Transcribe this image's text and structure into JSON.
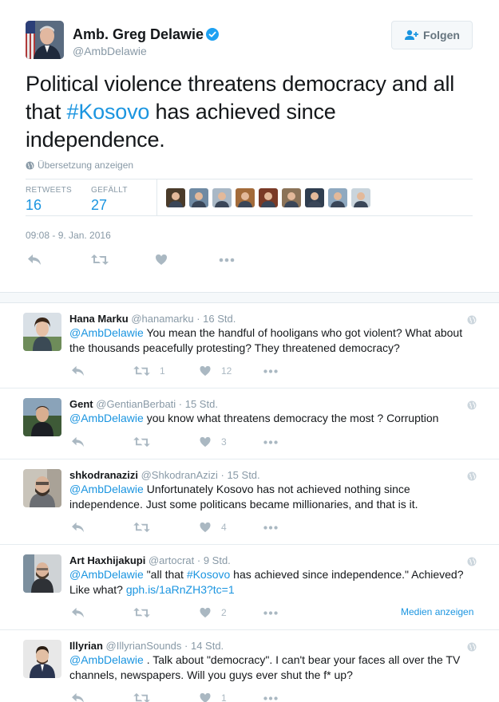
{
  "main_tweet": {
    "author_name": "Amb. Greg Delawie",
    "author_handle": "@AmbDelawie",
    "follow_label": "Folgen",
    "text_before": "Political violence threatens democracy and all that ",
    "hashtag": "#Kosovo",
    "text_after": " has achieved since independence.",
    "translate_label": "Übersetzung anzeigen",
    "retweets_label": "RETWEETS",
    "retweets_count": "16",
    "likes_label": "GEFÄLLT",
    "likes_count": "27",
    "timestamp": "09:08 - 9. Jan. 2016"
  },
  "likers": [
    {
      "name": "liker-1",
      "color": "#4a3b2a"
    },
    {
      "name": "liker-2",
      "color": "#6f8aa3"
    },
    {
      "name": "liker-3",
      "color": "#a9b8c6"
    },
    {
      "name": "liker-4",
      "color": "#a36b3a"
    },
    {
      "name": "liker-5",
      "color": "#7a3a26"
    },
    {
      "name": "liker-6",
      "color": "#8b7358"
    },
    {
      "name": "liker-7",
      "color": "#2f3d4f"
    },
    {
      "name": "liker-8",
      "color": "#8fa9c0"
    },
    {
      "name": "liker-9",
      "color": "#c9d4dc"
    }
  ],
  "replies": [
    {
      "name": "Hana Marku",
      "handle": "@hanamarku",
      "time": "16 Std.",
      "mention": "@AmbDelawie",
      "text_before": " You mean the handful of hooligans who got violent? What about the thousands peacefully protesting? They threatened democracy?",
      "hashtag": "",
      "text_middle": "",
      "link": "",
      "retweets": "1",
      "likes": "12",
      "media_label": ""
    },
    {
      "name": "Gent",
      "handle": "@GentianBerbati",
      "time": "15 Std.",
      "mention": "@AmbDelawie",
      "text_before": " you know what threatens democracy the most ? Corruption",
      "hashtag": "",
      "text_middle": "",
      "link": "",
      "retweets": "",
      "likes": "3",
      "media_label": ""
    },
    {
      "name": "shkodranazizi",
      "handle": "@ShkodranAzizi",
      "time": "15 Std.",
      "mention": "@AmbDelawie",
      "text_before": " Unfortunately Kosovo has not achieved nothing since independence. Just some politicans became millionaries, and that is it.",
      "hashtag": "",
      "text_middle": "",
      "link": "",
      "retweets": "",
      "likes": "4",
      "media_label": ""
    },
    {
      "name": "Art Haxhijakupi",
      "handle": "@artocrat",
      "time": "9 Std.",
      "mention": "@AmbDelawie",
      "text_before": " \"all that ",
      "hashtag": "#Kosovo",
      "text_middle": " has achieved since independence.\" Achieved? Like what? ",
      "link": "gph.is/1aRnZH3?tc=1",
      "retweets": "",
      "likes": "2",
      "media_label": "Medien anzeigen"
    },
    {
      "name": "Illyrian",
      "handle": "@IllyrianSounds",
      "time": "14 Std.",
      "mention": "@AmbDelawie",
      "text_before": " . Talk about \"democracy\". I can't bear your faces all over the TV channels, newspapers. Will you guys ever shut the f* up?",
      "hashtag": "",
      "text_middle": "",
      "link": "",
      "retweets": "",
      "likes": "1",
      "media_label": ""
    }
  ],
  "separator": " · ",
  "colors": {
    "link": "#1b95e0",
    "muted": "#8899a6",
    "action_icon": "#aab8c2",
    "verified": "#1da1f2"
  },
  "icons": {
    "reply": "reply-icon",
    "retweet": "retweet-icon",
    "like": "heart-icon",
    "more": "more-icon",
    "globe": "globe-icon",
    "follow": "follow-icon",
    "verified": "verified-badge-icon"
  }
}
